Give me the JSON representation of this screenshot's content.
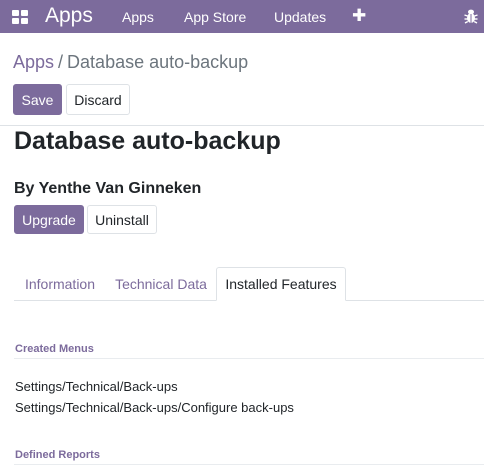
{
  "navbar": {
    "brand": "Apps",
    "items": [
      {
        "label": "Apps"
      },
      {
        "label": "App Store"
      },
      {
        "label": "Updates"
      }
    ],
    "icons": {
      "menu": "grid-icon",
      "add": "plus-icon",
      "debug": "bug-icon"
    },
    "plus_glyph": "✚",
    "background": "#7c6b9c"
  },
  "breadcrumb": {
    "parent": "Apps",
    "separator": "/",
    "current": "Database auto-backup"
  },
  "control_panel": {
    "save_label": "Save",
    "discard_label": "Discard"
  },
  "module": {
    "title": "Database auto-backup",
    "author": "By Yenthe Van Ginneken",
    "upgrade_label": "Upgrade",
    "uninstall_label": "Uninstall"
  },
  "tabs": [
    {
      "label": "Information",
      "active": false
    },
    {
      "label": "Technical Data",
      "active": false
    },
    {
      "label": "Installed Features",
      "active": true
    }
  ],
  "installed_features": {
    "created_menus_title": "Created Menus",
    "created_menus": [
      "Settings/Technical/Back-ups",
      "Settings/Technical/Back-ups/Configure back-ups"
    ],
    "defined_reports_title": "Defined Reports"
  },
  "colors": {
    "primary": "#7c6b9c",
    "text": "#212529",
    "muted": "#6c757d",
    "border": "#dee2e6"
  }
}
